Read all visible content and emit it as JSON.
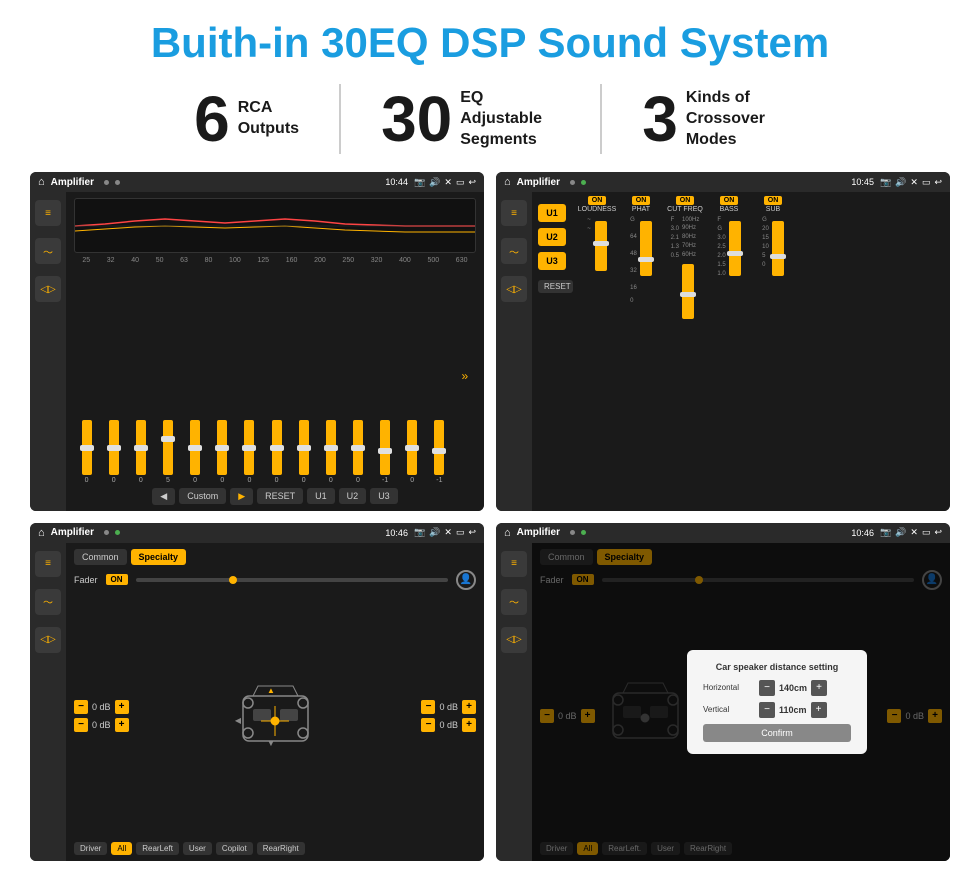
{
  "page": {
    "title": "Buith-in 30EQ DSP Sound System",
    "stats": [
      {
        "number": "6",
        "text": "RCA\nOutputs"
      },
      {
        "number": "30",
        "text": "EQ Adjustable\nSegments"
      },
      {
        "number": "3",
        "text": "Kinds of\nCrossover Modes"
      }
    ]
  },
  "screens": {
    "eq_screen": {
      "app_name": "Amplifier",
      "time": "10:44",
      "freq_labels": [
        "25",
        "32",
        "40",
        "50",
        "63",
        "80",
        "100",
        "125",
        "160",
        "200",
        "250",
        "320",
        "400",
        "500",
        "630"
      ],
      "slider_values": [
        "0",
        "0",
        "0",
        "5",
        "0",
        "0",
        "0",
        "0",
        "0",
        "0",
        "0",
        "-1",
        "0",
        "-1"
      ],
      "eq_mode": "Custom",
      "buttons": [
        "RESET",
        "U1",
        "U2",
        "U3"
      ]
    },
    "crossover_screen": {
      "app_name": "Amplifier",
      "time": "10:45",
      "u_buttons": [
        "U1",
        "U2",
        "U3"
      ],
      "controls": [
        "LOUDNESS",
        "PHAT",
        "CUT FREQ",
        "BASS",
        "SUB"
      ],
      "reset_label": "RESET"
    },
    "fader_screen": {
      "app_name": "Amplifier",
      "time": "10:46",
      "tabs": [
        "Common",
        "Specialty"
      ],
      "fader_label": "Fader",
      "fader_on": "ON",
      "vol_rows": [
        {
          "left": "0 dB",
          "right": "0 dB"
        },
        {
          "left": "0 dB",
          "right": "0 dB"
        }
      ],
      "bottom_btns": [
        "Driver",
        "RearLeft",
        "All",
        "User",
        "Copilot",
        "RearRight"
      ]
    },
    "distance_screen": {
      "app_name": "Amplifier",
      "time": "10:46",
      "tabs": [
        "Common",
        "Specialty"
      ],
      "dialog_title": "Car speaker distance setting",
      "horizontal_label": "Horizontal",
      "horizontal_val": "140cm",
      "vertical_label": "Vertical",
      "vertical_val": "110cm",
      "confirm_label": "Confirm",
      "vol_rows": [
        {
          "right": "0 dB"
        },
        {
          "right": "0 dB"
        }
      ],
      "bottom_btns": [
        "Driver",
        "RearLeft.",
        "All",
        "User",
        "RearRight"
      ]
    }
  },
  "colors": {
    "accent": "#1a9de0",
    "orange": "#FFB300",
    "dark_bg": "#1a1a1a",
    "title_blue": "#1a9de0"
  }
}
